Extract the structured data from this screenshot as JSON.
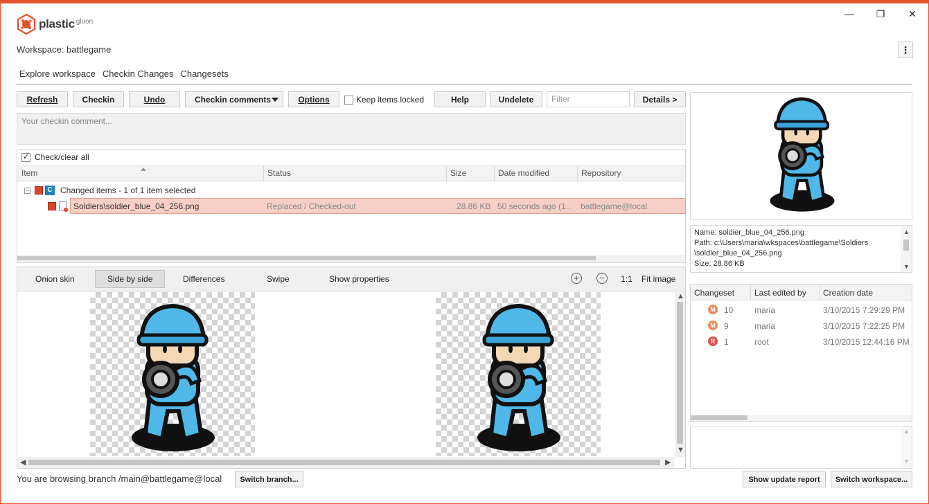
{
  "app": {
    "name": "plastic",
    "sub": "gluon",
    "minimize": "—",
    "restore": "❐",
    "close": "✕",
    "more": "⋮"
  },
  "workspace": {
    "label": "Workspace: battlegame"
  },
  "tabs": [
    "Explore workspace",
    "Checkin Changes",
    "Changesets"
  ],
  "toolbar": {
    "refresh": "Refresh",
    "checkin": "Checkin",
    "undo": "Undo",
    "checkin_comments": "Checkin comments",
    "options": "Options",
    "keep_locked": "Keep items locked",
    "help": "Help",
    "undelete": "Undelete",
    "filter_placeholder": "Filter",
    "details": "Details >"
  },
  "comment_placeholder": "Your checkin comment...",
  "check_all": "Check/clear all",
  "columns": [
    "Item",
    "Status",
    "Size",
    "Date modified",
    "Repository"
  ],
  "group": {
    "badge": "C",
    "label": "Changed items - 1 of 1 item selected"
  },
  "item": {
    "name": "Soldiers\\soldier_blue_04_256.png",
    "status": "Replaced / Checked-out",
    "size": "28.86 KB",
    "date": "50 seconds ago (1...",
    "repo": "battlegame@local"
  },
  "diff_tabs": [
    "Onion skin",
    "Side by side",
    "Differences",
    "Swipe",
    "Show properties"
  ],
  "zoom": {
    "in": "+",
    "out": "−",
    "one": "1:1",
    "fit": "Fit image"
  },
  "info": {
    "name": "Name: soldier_blue_04_256.png",
    "path1": "Path: c:\\Users\\maria\\wkspaces\\battlegame\\Soldiers",
    "path2": "\\soldier_blue_04_256.png",
    "size": "Size: 28.86 KB"
  },
  "history": {
    "columns": [
      "Changeset",
      "Last edited by",
      "Creation date"
    ],
    "rows": [
      {
        "badge": "M",
        "cs": "10",
        "by": "maria",
        "date": "3/10/2015 7:29:29 PM"
      },
      {
        "badge": "M",
        "cs": "9",
        "by": "maria",
        "date": "3/10/2015 7:22:25 PM"
      },
      {
        "badge": "R",
        "cs": "1",
        "by": "root",
        "date": "3/10/2015 12:44:16 PM"
      }
    ]
  },
  "status": {
    "text": "You are browsing branch /main@battlegame@local",
    "switch_branch": "Switch branch..."
  },
  "footer": {
    "update_report": "Show update report",
    "switch_workspace": "Switch workspace..."
  },
  "colors": {
    "accent": "#e2532b",
    "selected_row": "#f7cfc6",
    "soldier": "#4fb8e8"
  }
}
